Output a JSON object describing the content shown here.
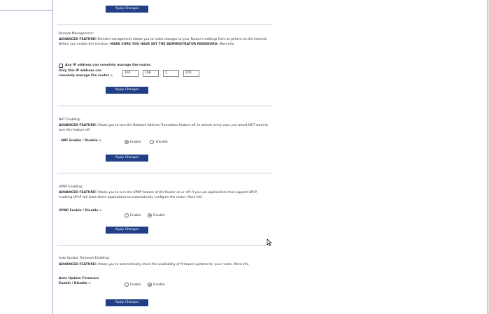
{
  "buttons": {
    "apply": "Apply Changes"
  },
  "remote": {
    "title": "Remote Management:",
    "desc_bold": "ADVANCED FEATURE!",
    "desc_text": " Remote management allows you to make changes to your Router's settings from anywhere on the Internet. Before you enable this function, ",
    "desc_warning": "MAKE SURE YOU HAVE SET THE ADMINISTRATOR PASSWORD.",
    "more_info": " More Info",
    "any_ip_label": "Any IP address can remotely manage the router.",
    "only_ip_label_1": "Only this IP address can",
    "only_ip_label_2": "remotely manage the router >",
    "ip": [
      "192",
      "168",
      "2",
      "100"
    ]
  },
  "nat": {
    "title": "NAT Enabling:",
    "desc_bold": "ADVANCED FEATURE!",
    "desc_text": " Allows you to turn the Network Address Translation feature off. In almost every case you would NOT want to turn this feature off.",
    "label": "- NAT Enable / Disable >",
    "enable": "Enable",
    "disable": "Disable"
  },
  "upnp": {
    "title": "UPNP Enabling:",
    "desc_bold": "ADVANCED FEATURE!",
    "desc_text": " Allows you to turn the UPNP feature of the Router on or off. If you use applications that support UPnP, enabling UPnP will allow these applications to automatically configure the router.",
    "more_info": " More Info",
    "label": "UPNP Enable / Disable >",
    "enable": "Enable",
    "disable": "Disable"
  },
  "firmware": {
    "title": "Auto Update Firmware Enabling:",
    "desc_bold": "ADVANCED FEATURE!",
    "desc_text": " Allows you to automatically check the availability of firmware updates for your router.",
    "more_info": " More Info",
    "label_1": "Auto Update Firmware",
    "label_2": "Enable / Disable >",
    "enable": "Enable",
    "disable": "Disable"
  }
}
